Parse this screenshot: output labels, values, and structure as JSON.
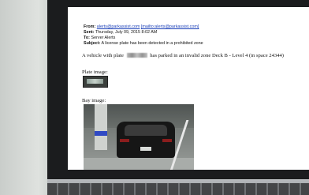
{
  "email": {
    "from_label": "From:",
    "from_address": "alerts@parkassist.com",
    "from_mailto": "[mailto:alerts@parkassist.com]",
    "sent_label": "Sent:",
    "sent_value": "Thursday, July 09, 2015 8:02 AM",
    "to_label": "To:",
    "to_value": "Server Alerts",
    "subject_label": "Subject:",
    "subject_value": "A license plate has been detected in a prohibited zone"
  },
  "body": {
    "message_before": "A vehicle with plate",
    "message_after": "has parked in an invalid zone Deck B - Level 4 (in space 24344)",
    "plate_label": "Plate image:",
    "bay_label": "Bay image:"
  }
}
